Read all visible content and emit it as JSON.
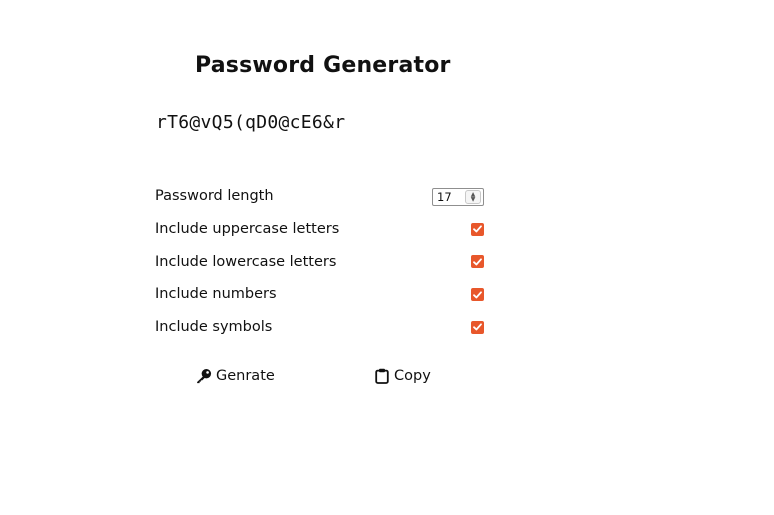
{
  "app": {
    "title": "Password Generator",
    "password": "rT6@vQ5(qD0@cE6&r"
  },
  "options": [
    {
      "label": "Password length",
      "type": "number",
      "value": "17"
    },
    {
      "label": "Include uppercase letters",
      "type": "checkbox",
      "checked": true
    },
    {
      "label": "Include lowercase letters",
      "type": "checkbox",
      "checked": true
    },
    {
      "label": "Include numbers",
      "type": "checkbox",
      "checked": true
    },
    {
      "label": "Include symbols",
      "type": "checkbox",
      "checked": true
    }
  ],
  "actions": {
    "generate": {
      "label": "Genrate",
      "icon": "key-icon"
    },
    "copy": {
      "label": "Copy",
      "icon": "clipboard-icon"
    }
  },
  "colors": {
    "checkbox_accent": "#e8572b",
    "text": "#111111",
    "background": "#ffffff"
  }
}
